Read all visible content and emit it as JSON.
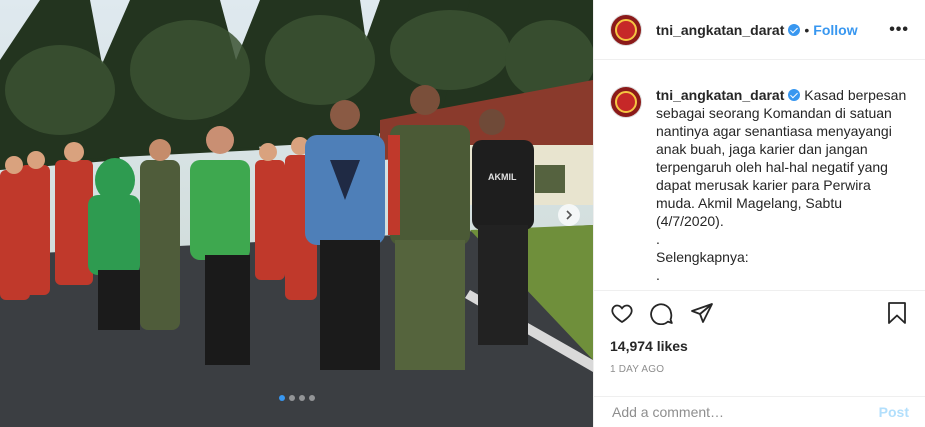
{
  "header": {
    "username": "tni_angkatan_darat",
    "separator": "•",
    "follow_label": "Follow",
    "more_label": "•••"
  },
  "caption": {
    "username": "tni_angkatan_darat",
    "lines": [
      "Kasad berpesan",
      "sebagai seorang Komandan di satuan",
      "nantinya agar senantiasa menyayangi",
      "anak buah, jaga karier dan jangan",
      "terpengaruh oleh hal-hal negatif yang",
      "dapat merusak karier para Perwira",
      "muda. Akmil Magelang, Sabtu",
      "(4/7/2020).",
      ".",
      "Selengkapnya:",
      "."
    ]
  },
  "photo": {
    "shirt_text": "AKMIL",
    "carousel_count": 4,
    "carousel_active": 1
  },
  "stats": {
    "likes": "14,974 likes",
    "time": "1 DAY AGO"
  },
  "comment": {
    "placeholder": "Add a comment…",
    "post_label": "Post"
  },
  "icons": {
    "verified": "verified-badge-icon",
    "like": "heart-icon",
    "comment": "comment-bubble-icon",
    "share": "paper-plane-icon",
    "save": "bookmark-icon",
    "next": "chevron-right-icon"
  },
  "colors": {
    "link_blue": "#3897f0",
    "post_disabled": "#b2dffc",
    "muted": "#8e8e8e"
  }
}
